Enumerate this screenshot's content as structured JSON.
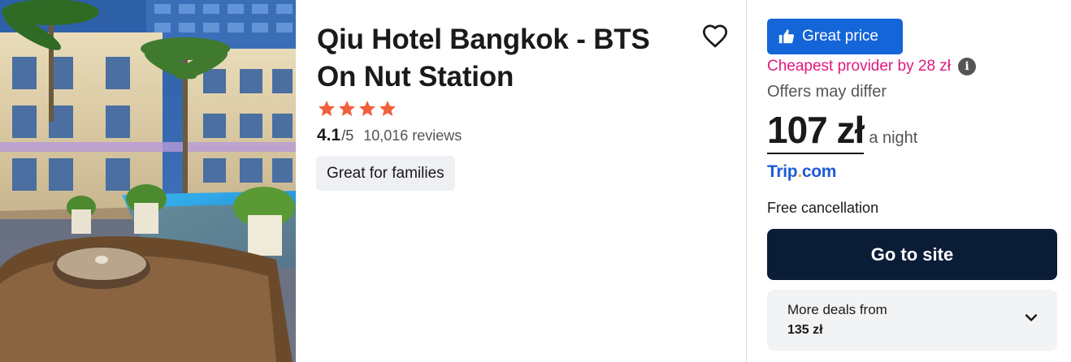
{
  "hotel": {
    "name": "Qiu Hotel Bangkok -  BTS On Nut Station",
    "star_rating": 4,
    "rating_score": "4.1",
    "rating_scale": "/5",
    "reviews": "10,016 reviews",
    "tag": "Great for families"
  },
  "pricing": {
    "badge_label": "Great price",
    "cheapest_text": "Cheapest provider by 28 zł",
    "offers_note": "Offers may differ",
    "price": "107 zł",
    "per_night": "a night",
    "provider_name_part1": "Trip",
    "provider_dot": ".",
    "provider_name_part2": "com",
    "cancellation": "Free cancellation",
    "cta_label": "Go to site",
    "more_deals_label": "More deals from",
    "more_deals_price": "135 zł"
  },
  "colors": {
    "badge_bg": "#1365d8",
    "cheapest_text": "#e0187e",
    "star": "#f0603c",
    "cta_bg": "#0b1d36",
    "provider": "#1f5bd6"
  },
  "icons": {
    "favorite": "heart-outline-icon",
    "badge": "thumbs-up-icon",
    "info": "info-icon",
    "expand": "chevron-down-icon",
    "rating": "star-icon"
  }
}
